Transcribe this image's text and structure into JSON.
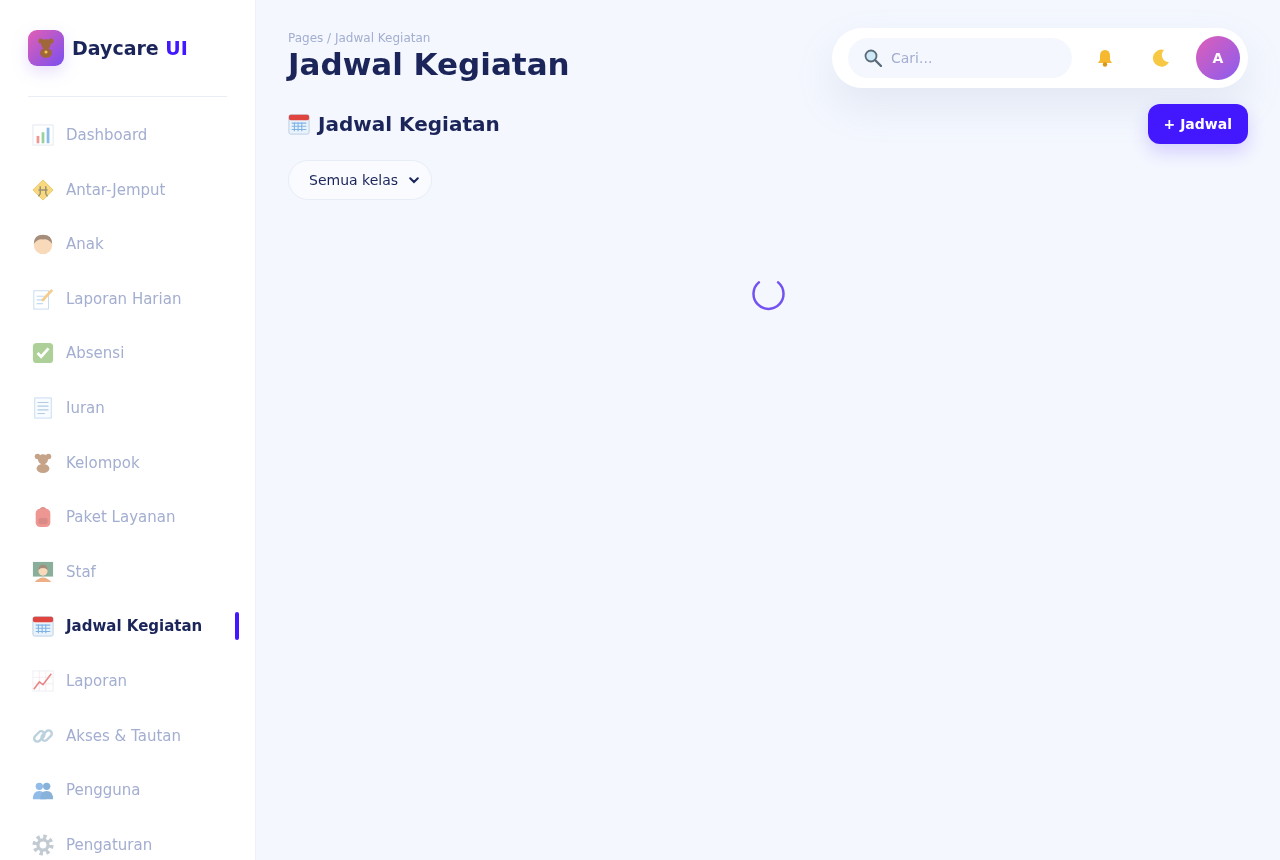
{
  "sidebar": {
    "brand": {
      "name": "Daycare",
      "accent": "UI"
    },
    "items": [
      {
        "label": "Dashboard",
        "selected": false
      },
      {
        "label": "Antar-Jemput",
        "selected": false
      },
      {
        "label": "Anak",
        "selected": false
      },
      {
        "label": "Laporan Harian",
        "selected": false
      },
      {
        "label": "Absensi",
        "selected": false
      },
      {
        "label": "Iuran",
        "selected": false
      },
      {
        "label": "Kelompok",
        "selected": false
      },
      {
        "label": "Paket Layanan",
        "selected": false
      },
      {
        "label": "Staf",
        "selected": false
      },
      {
        "label": "Jadwal Kegiatan",
        "selected": true
      },
      {
        "label": "Laporan",
        "selected": false
      },
      {
        "label": "Akses & Tautan",
        "selected": false
      },
      {
        "label": "Pengguna",
        "selected": false
      },
      {
        "label": "Pengaturan",
        "selected": false
      }
    ]
  },
  "header": {
    "breadcrumb": "Pages / Jadwal Kegiatan",
    "title": "Jadwal Kegiatan"
  },
  "topbar": {
    "search": {
      "placeholder": "Cari..."
    },
    "avatar": "A"
  },
  "content": {
    "title": "Jadwal Kegiatan",
    "add_button": "+ Jadwal",
    "class_filter": "Semua kelas",
    "loading": true
  }
}
